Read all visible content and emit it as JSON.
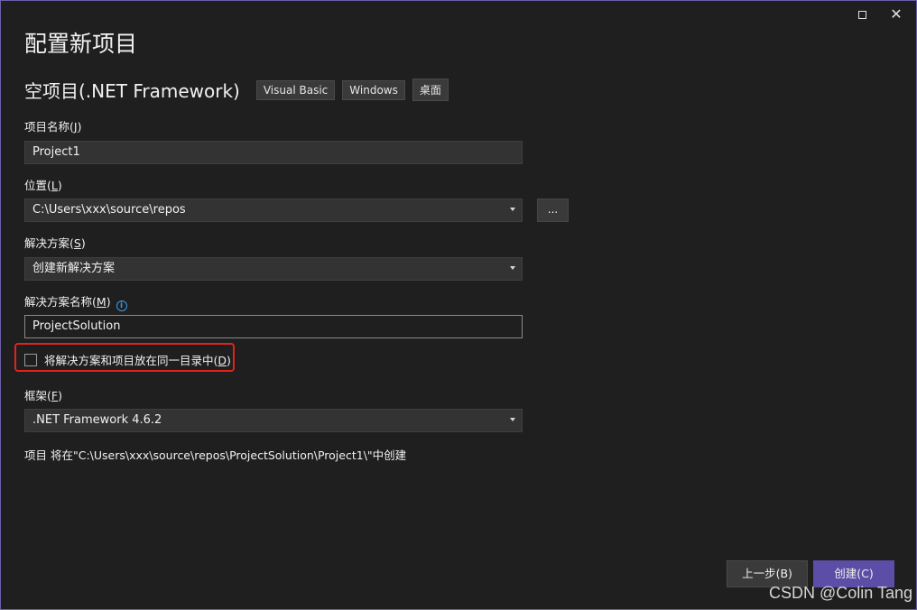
{
  "page_title": "配置新项目",
  "template": {
    "name": "空项目(.NET Framework)",
    "tags": [
      "Visual Basic",
      "Windows",
      "桌面"
    ]
  },
  "project_name": {
    "label": "项目名称(",
    "key": "J",
    "label_end": ")",
    "value": "Project1"
  },
  "location": {
    "label": "位置(",
    "key": "L",
    "label_end": ")",
    "value": "C:\\Users\\xxx\\source\\repos",
    "browse_label": "..."
  },
  "solution": {
    "label": "解决方案(",
    "key": "S",
    "label_end": ")",
    "value": "创建新解决方案"
  },
  "solution_name": {
    "label": "解决方案名称(",
    "key": "M",
    "label_end": ")",
    "value": "ProjectSolution",
    "info_icon": "i"
  },
  "same_dir": {
    "label": "将解决方案和项目放在同一目录中(",
    "key": "D",
    "label_end": ")",
    "checked": false
  },
  "framework": {
    "label": "框架(",
    "key": "F",
    "label_end": ")",
    "value": ".NET Framework 4.6.2"
  },
  "path_info": "项目 将在\"C:\\Users\\xxx\\source\\repos\\ProjectSolution\\Project1\\\"中创建",
  "buttons": {
    "back": "上一步(B)",
    "create": "创建(C)"
  },
  "window_controls": {
    "close": "✕"
  },
  "watermark": "CSDN @Colin Tang",
  "colors": {
    "accent": "#5c4ea6",
    "highlight": "#e2231a",
    "info": "#3c9be8"
  }
}
